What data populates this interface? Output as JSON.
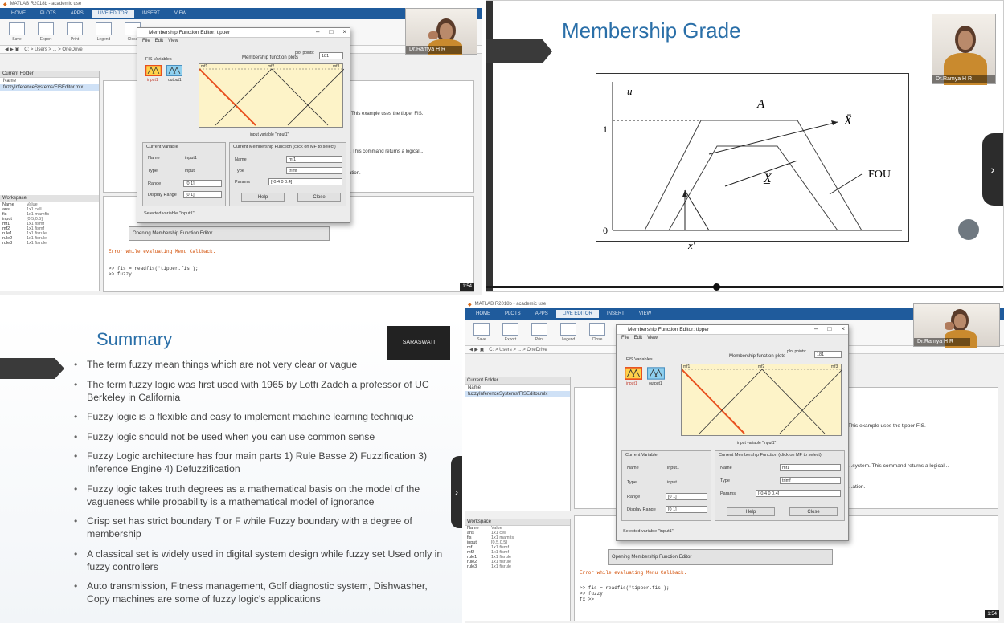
{
  "quad1": {
    "app_title": "MATLAB R2018b - academic use",
    "tabs": [
      "HOME",
      "PLOTS",
      "APPS",
      "LIVE EDITOR",
      "INSERT",
      "VIEW"
    ],
    "ribbon": [
      "Save",
      "Export",
      "Print",
      "Legend",
      "Close"
    ],
    "path": "C: > Users > ... > OneDrive",
    "current_folder_label": "Current Folder",
    "folder_header": "Name",
    "folder_item": "fuzzyInferenceSystems/FISEditor.mlx",
    "workspace_label": "Workspace",
    "workspace_columns": [
      "Name",
      "Value"
    ],
    "workspace_rows": [
      [
        "ans",
        "1x1 cell"
      ],
      [
        "fis",
        "1x1 mamfis"
      ],
      [
        "input",
        "[0.5,0.5]"
      ],
      [
        "mf1",
        "1x1 fismf"
      ],
      [
        "mf2",
        "1x1 fismf"
      ],
      [
        "rule1",
        "1x1 fisrule"
      ],
      [
        "rule2",
        "1x1 fisrule"
      ],
      [
        "rule3",
        "1x1 fisrule"
      ]
    ],
    "editor_texts": [
      "This example uses the tipper FIS.",
      "...system. This command returns a logical...",
      "...ation."
    ],
    "cmd_lines": [
      "Error while evaluating Menu Callback.",
      ">> fis = readfis('tipper.fis');",
      ">> fuzzy",
      "fx >>"
    ],
    "mf_window": {
      "title": "Membership Function Editor: tipper",
      "menu": [
        "File",
        "Edit",
        "View"
      ],
      "fis_variables": "FIS Variables",
      "plot_title": "Membership function plots",
      "plot_points_label": "plot points:",
      "plot_points": "181",
      "mf_labels": [
        "mf1",
        "mf2",
        "mf3"
      ],
      "axis_label": "input variable \"input1\"",
      "var_inputs": [
        "input1",
        "output1"
      ],
      "current_variable": "Current Variable",
      "name_label": "Name",
      "name_value": "input1",
      "type_label": "Type",
      "type_value": "input",
      "range_label": "Range",
      "range_value": "[0 1]",
      "display_label": "Display Range",
      "display_value": "[0 1]",
      "current_mf": "Current Membership Function (click on MF to select)",
      "mf_name_label": "Name",
      "mf_name_value": "mf1",
      "mf_type_label": "Type",
      "mf_type_value": "trimf",
      "params_label": "Params",
      "params_value": "[-0.4 0 0.4]",
      "help_button": "Help",
      "close_button": "Close",
      "status": "Selected variable \"input1\"",
      "status2": "Opening Membership Function Editor"
    },
    "page_badge": "1:54"
  },
  "quad2": {
    "title": "Membership Grade",
    "camera_name": "Dr.Ramya H R",
    "fig_labels": {
      "u": "u",
      "one": "1",
      "zero": "0",
      "A": "A",
      "X_upper": "X̄",
      "X_lower": "X̲",
      "FOU": "FOU",
      "x_axis": "x'"
    }
  },
  "quad3": {
    "title": "Summary",
    "badge": "SARASWATI",
    "bullets": [
      "The term fuzzy mean things which are not very clear or vague",
      "The term fuzzy logic was first used with 1965 by Lotfi Zadeh a professor of UC Berkeley in California",
      "Fuzzy logic is a flexible and easy to implement machine learning technique",
      "Fuzzy logic should not be used when you can use common sense",
      "Fuzzy Logic architecture has four main parts 1) Rule Basse 2) Fuzzification 3) Inference Engine 4) Defuzzification",
      "Fuzzy logic takes truth degrees as a mathematical basis on the model of the vagueness while probability is a mathematical model of ignorance",
      "Crisp set has strict boundary T or F while Fuzzy boundary with a degree of membership",
      "A classical set is widely used in digital system design while fuzzy set Used only in fuzzy controllers",
      "Auto transmission, Fitness management, Golf diagnostic system, Dishwasher, Copy machines are some of fuzzy logic's applications"
    ]
  },
  "quad4": {
    "camera_name": "Dr.Ramya H R",
    "page_badge": "1:54"
  },
  "colors": {
    "matlab_blue": "#1f5b9c",
    "slide_title": "#2a6fa8",
    "plot_bg": "#fdf3c8",
    "selected_mf": "#e8501e"
  }
}
